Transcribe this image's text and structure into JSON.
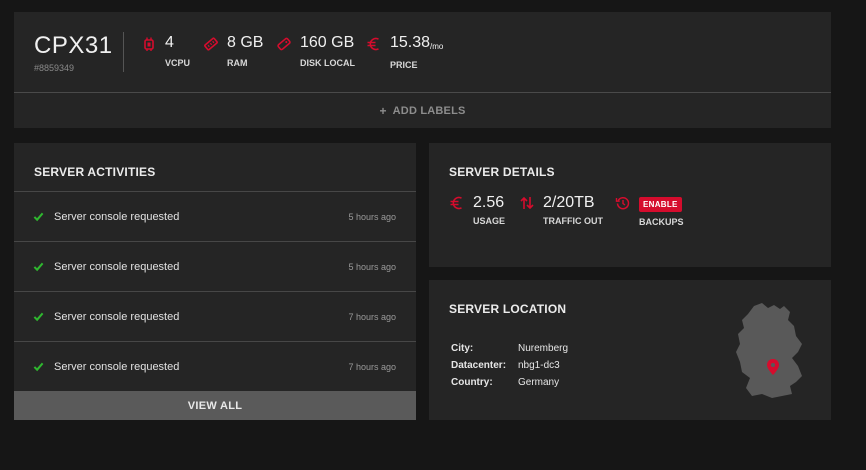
{
  "server": {
    "name": "CPX31",
    "id": "#8859349",
    "specs": [
      {
        "icon": "cpu-icon",
        "value": "4",
        "label": "VCPU"
      },
      {
        "icon": "ram-icon",
        "value": "8 GB",
        "label": "RAM"
      },
      {
        "icon": "disk-icon",
        "value": "160 GB",
        "label": "DISK LOCAL"
      },
      {
        "icon": "euro-icon",
        "value": "15.38",
        "unit": "/mo",
        "label": "PRICE"
      }
    ],
    "add_labels": "ADD LABELS"
  },
  "activities": {
    "title": "SERVER ACTIVITIES",
    "items": [
      {
        "text": "Server console requested",
        "time": "5 hours ago"
      },
      {
        "text": "Server console requested",
        "time": "5 hours ago"
      },
      {
        "text": "Server console requested",
        "time": "7 hours ago"
      },
      {
        "text": "Server console requested",
        "time": "7 hours ago"
      }
    ],
    "view_all": "VIEW ALL"
  },
  "details": {
    "title": "SERVER DETAILS",
    "usage": {
      "value": "2.56",
      "label": "USAGE"
    },
    "traffic": {
      "value": "2/20TB",
      "label": "TRAFFIC OUT"
    },
    "backups": {
      "button": "ENABLE",
      "label": "BACKUPS"
    }
  },
  "location": {
    "title": "SERVER LOCATION",
    "city_label": "City:",
    "city": "Nuremberg",
    "datacenter_label": "Datacenter:",
    "datacenter": "nbg1-dc3",
    "country_label": "Country:",
    "country": "Germany"
  },
  "colors": {
    "accent": "#d50c2d",
    "check": "#2fb72f",
    "panel": "#252525",
    "background": "#161616"
  }
}
